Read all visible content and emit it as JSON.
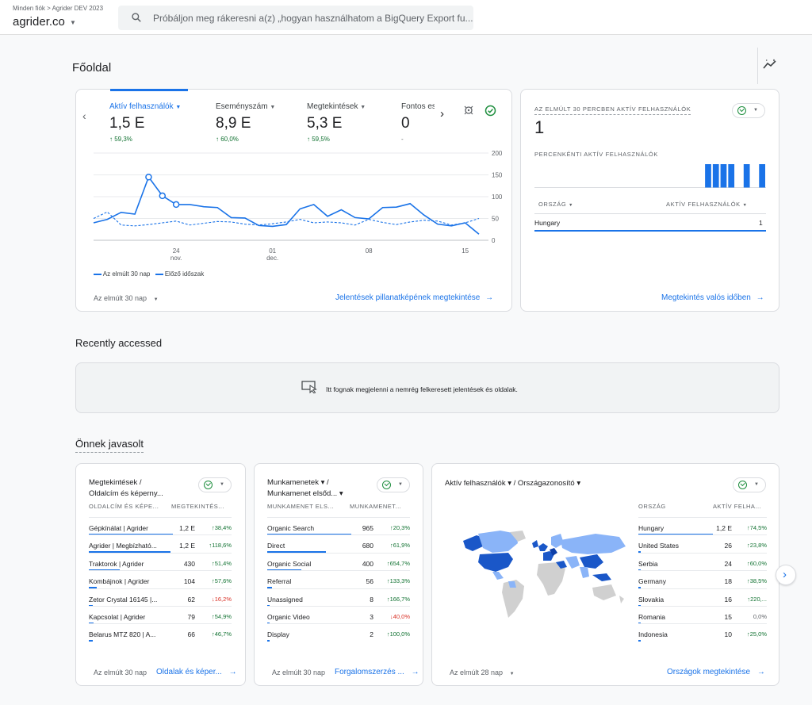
{
  "header": {
    "breadcrumb": "Minden fiók > Agrider DEV 2023",
    "account": "agrider.co",
    "search_placeholder": "Próbáljon meg rákeresni a(z) „hogyan használhatom a BigQuery Export fu..."
  },
  "page": {
    "title": "Főoldal"
  },
  "overview": {
    "metrics": [
      {
        "label": "Aktív felhasználók",
        "value": "1,5 E",
        "change": "↑ 59,3%"
      },
      {
        "label": "Eseményszám",
        "value": "8,9 E",
        "change": "↑ 60,0%"
      },
      {
        "label": "Megtekintések",
        "value": "5,3 E",
        "change": "↑ 59,5%"
      },
      {
        "label": "Fontos es",
        "value": "0",
        "change": "-"
      }
    ],
    "chart_data": {
      "type": "line",
      "x_ticks": [
        {
          "label": "24",
          "sub": "nov.",
          "index": 6
        },
        {
          "label": "01",
          "sub": "dec.",
          "index": 13
        },
        {
          "label": "08",
          "sub": "",
          "index": 20
        },
        {
          "label": "15",
          "sub": "",
          "index": 27
        }
      ],
      "y_ticks": [
        "200",
        "150",
        "100",
        "50",
        "0"
      ],
      "ylim": [
        0,
        200
      ],
      "series": [
        {
          "name": "Az elmúlt 30 nap",
          "style": "solid",
          "color": "#1a73e8",
          "values": [
            40,
            48,
            64,
            60,
            145,
            102,
            82,
            82,
            77,
            75,
            52,
            51,
            34,
            32,
            36,
            72,
            82,
            55,
            70,
            52,
            49,
            75,
            76,
            84,
            58,
            37,
            33,
            40,
            14
          ]
        },
        {
          "name": "Előző időszak",
          "style": "dashed",
          "color": "#1a73e8",
          "values": [
            50,
            65,
            35,
            33,
            36,
            40,
            44,
            35,
            39,
            43,
            42,
            37,
            35,
            38,
            42,
            48,
            40,
            42,
            40,
            35,
            48,
            41,
            36,
            42,
            46,
            44,
            35,
            40,
            50
          ]
        }
      ]
    },
    "period": "Az elmúlt 30 nap",
    "link": "Jelentések pillanatképének megtekintése"
  },
  "realtime": {
    "title": "AZ ELMÚLT 30 PERCBEN AKTÍV FELHASZNÁLÓK",
    "value": "1",
    "per_minute_label": "PERCENKÉNTI AKTÍV FELHASZNÁLÓK",
    "per_minute_values": [
      0,
      0,
      0,
      0,
      0,
      0,
      0,
      0,
      0,
      0,
      0,
      0,
      0,
      0,
      0,
      0,
      0,
      0,
      0,
      0,
      0,
      0,
      1,
      1,
      1,
      1,
      0,
      1,
      0,
      1
    ],
    "col_country": "ORSZÁG",
    "col_users": "AKTÍV FELHASZNÁLÓK",
    "rows": [
      {
        "country": "Hungary",
        "users": "1"
      }
    ],
    "link": "Megtekintés valós időben"
  },
  "recent": {
    "title": "Recently accessed",
    "empty": "Itt fognak megjelenni a nemrég felkeresett jelentések és oldalak."
  },
  "suggested": {
    "title": "Önnek javasolt",
    "cards": [
      {
        "title1": "Megtekintések /",
        "title2": "Oldalcím és képerny...",
        "col1": "OLDALCÍM ÉS KÉPE...",
        "col2": "MEGTEKINTÉS...",
        "rows": [
          {
            "name": "Gépkínálat | Agrider",
            "value": "1,2 E",
            "change": "↑38,4%",
            "dir": "up",
            "bar": 1.0
          },
          {
            "name": "Agrider | Megbízható...",
            "value": "1,2 E",
            "change": "↑118,6%",
            "dir": "up",
            "bar": 0.97
          },
          {
            "name": "Traktorok | Agrider",
            "value": "430",
            "change": "↑51,4%",
            "dir": "up",
            "bar": 0.37
          },
          {
            "name": "Kombájnok | Agrider",
            "value": "104",
            "change": "↑57,6%",
            "dir": "up",
            "bar": 0.09
          },
          {
            "name": "Zetor Crystal 16145 |...",
            "value": "62",
            "change": "↓16,2%",
            "dir": "down",
            "bar": 0.05
          },
          {
            "name": "Kapcsolat | Agrider",
            "value": "79",
            "change": "↑54,9%",
            "dir": "up",
            "bar": 0.06
          },
          {
            "name": "Belarus MTZ 820 | A...",
            "value": "66",
            "change": "↑46,7%",
            "dir": "up",
            "bar": 0.05
          }
        ],
        "period": "Az elmúlt 30 nap",
        "link": "Oldalak és képer..."
      },
      {
        "title1": "Munkamenetek ▾ /",
        "title2": "Munkamenet elsőd... ▾",
        "col1": "MUNKAMENET ELS...",
        "col2": "MUNKAMENET...",
        "rows": [
          {
            "name": "Organic Search",
            "value": "965",
            "change": "↑20,3%",
            "dir": "up",
            "bar": 1.0
          },
          {
            "name": "Direct",
            "value": "680",
            "change": "↑61,9%",
            "dir": "up",
            "bar": 0.7
          },
          {
            "name": "Organic Social",
            "value": "400",
            "change": "↑654,7%",
            "dir": "up",
            "bar": 0.41
          },
          {
            "name": "Referral",
            "value": "56",
            "change": "↑133,3%",
            "dir": "up",
            "bar": 0.06
          },
          {
            "name": "Unassigned",
            "value": "8",
            "change": "↑166,7%",
            "dir": "up",
            "bar": 0.01
          },
          {
            "name": "Organic Video",
            "value": "3",
            "change": "↓40,0%",
            "dir": "down",
            "bar": 0.0
          },
          {
            "name": "Display",
            "value": "2",
            "change": "↑100,0%",
            "dir": "up",
            "bar": 0.0
          }
        ],
        "period": "Az elmúlt 30 nap",
        "link": "Forgalomszerzés ..."
      }
    ],
    "geo": {
      "title": "Aktív felhasználók ▾ / Országazonosító ▾",
      "col1": "ORSZÁG",
      "col2": "AKTÍV FELHA...",
      "rows": [
        {
          "name": "Hungary",
          "value": "1,2 E",
          "change": "↑74,5%",
          "dir": "up",
          "bar": 1.0
        },
        {
          "name": "United States",
          "value": "26",
          "change": "↑23,8%",
          "dir": "up",
          "bar": 0.02
        },
        {
          "name": "Serbia",
          "value": "24",
          "change": "↑60,0%",
          "dir": "up",
          "bar": 0.02
        },
        {
          "name": "Germany",
          "value": "18",
          "change": "↑38,5%",
          "dir": "up",
          "bar": 0.015
        },
        {
          "name": "Slovakia",
          "value": "16",
          "change": "↑220,...",
          "dir": "up",
          "bar": 0.013
        },
        {
          "name": "Romania",
          "value": "15",
          "change": "0,0%",
          "dir": "flat",
          "bar": 0.012
        },
        {
          "name": "Indonesia",
          "value": "10",
          "change": "↑25,0%",
          "dir": "up",
          "bar": 0.008
        }
      ],
      "period": "Az elmúlt 28 nap",
      "link": "Országok megtekintése"
    }
  }
}
